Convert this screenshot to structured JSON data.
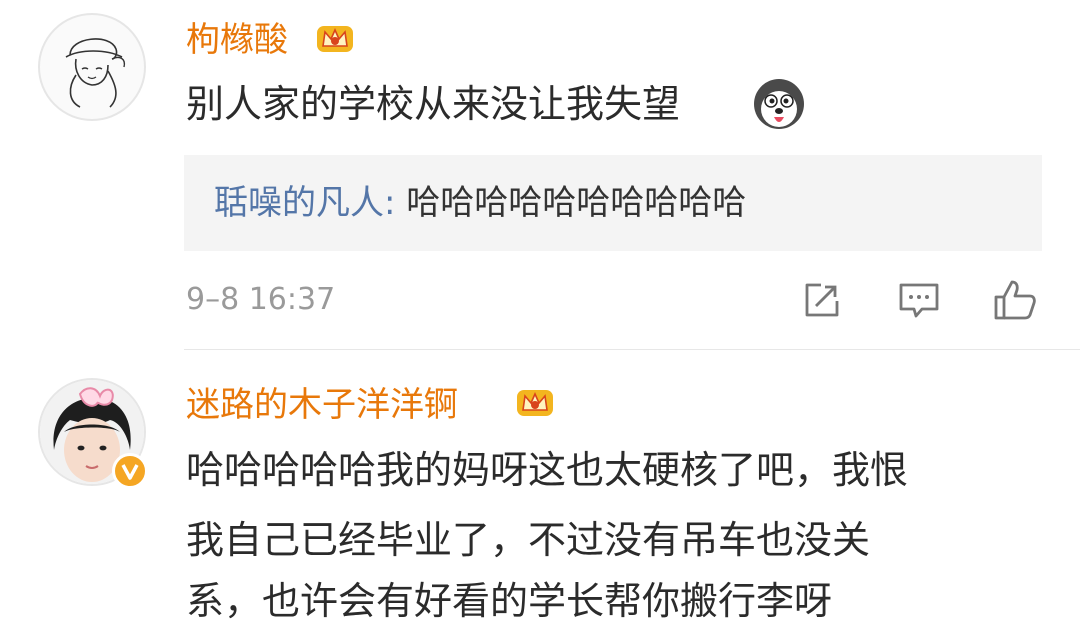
{
  "comments": [
    {
      "username": "枸橼酸",
      "text": "别人家的学校从来没让我失望",
      "emoji": "husky-emoji",
      "reply": {
        "user": "聒噪的凡人",
        "separator": ":",
        "text": "哈哈哈哈哈哈哈哈哈哈"
      },
      "timestamp": "9–8 16:37",
      "actions": [
        "share-icon",
        "comment-icon",
        "like-icon"
      ]
    },
    {
      "username": "迷路的木子洋洋锕",
      "verified": true,
      "text_lines": [
        "哈哈哈哈哈我的妈呀这也太硬核了吧，我恨",
        "我自己已经毕业了，不过没有吊车也没关",
        "系，也许会有好看的学长帮你搬行李呀"
      ]
    }
  ],
  "colors": {
    "username": "#e8780a",
    "reply_user": "#5476a8",
    "timestamp": "#9a9a9a",
    "reply_background": "#f4f4f4"
  }
}
